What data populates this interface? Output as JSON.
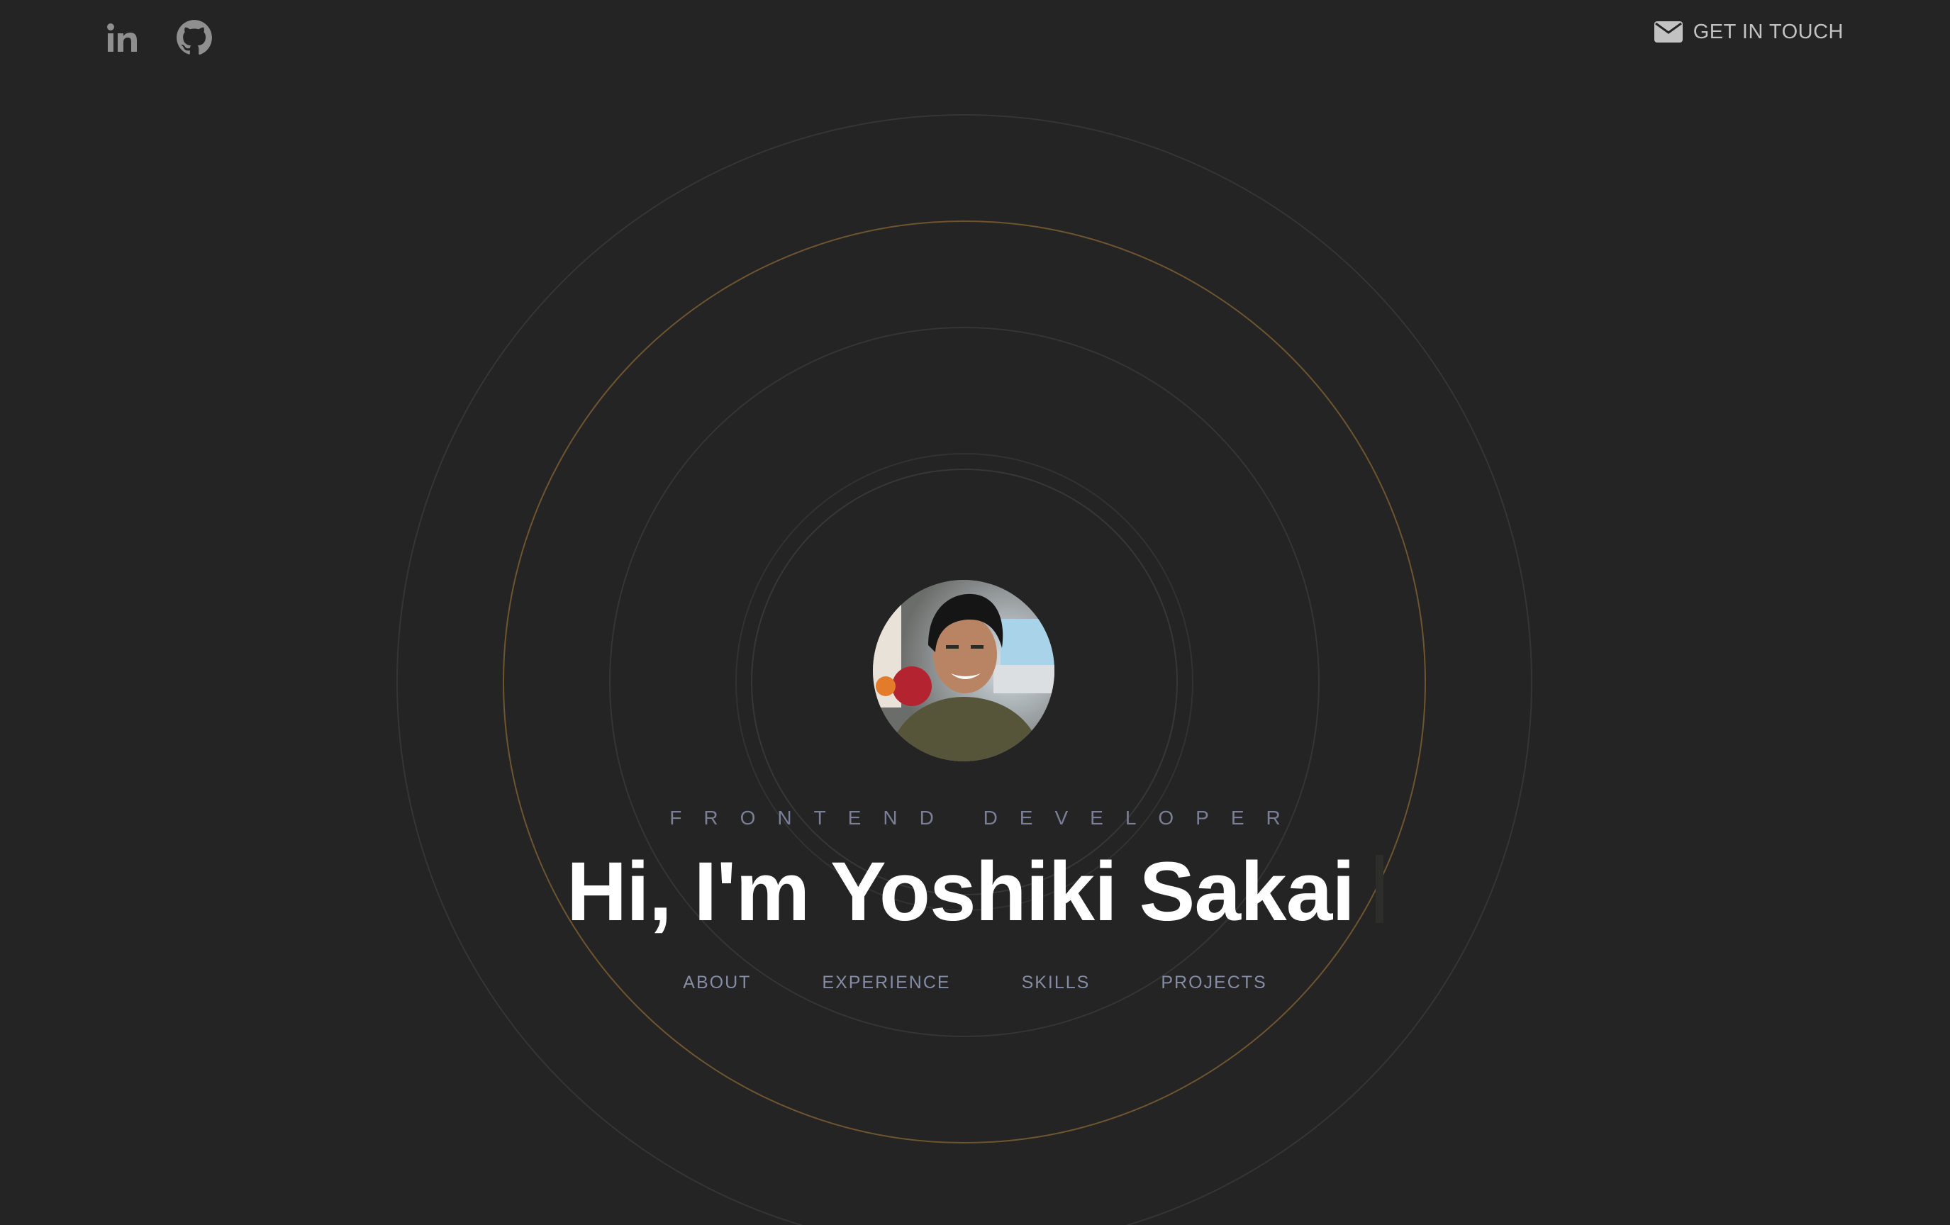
{
  "header": {
    "social": [
      {
        "name": "linkedin",
        "icon": "linkedin-icon"
      },
      {
        "name": "github",
        "icon": "github-icon"
      }
    ],
    "contact": {
      "icon": "envelope-icon",
      "label": "GET IN TOUCH"
    }
  },
  "hero": {
    "avatar_alt": "",
    "role": "FRONTEND DEVELOPER",
    "title": "Hi, I'm Yoshiki Sakai"
  },
  "nav": {
    "items": [
      "ABOUT",
      "EXPERIENCE",
      "SKILLS",
      "PROJECTS"
    ]
  },
  "colors": {
    "background": "#242424",
    "accent_ring": "#8b6a32",
    "text_muted": "#858ca3",
    "title": "#ffffff"
  }
}
